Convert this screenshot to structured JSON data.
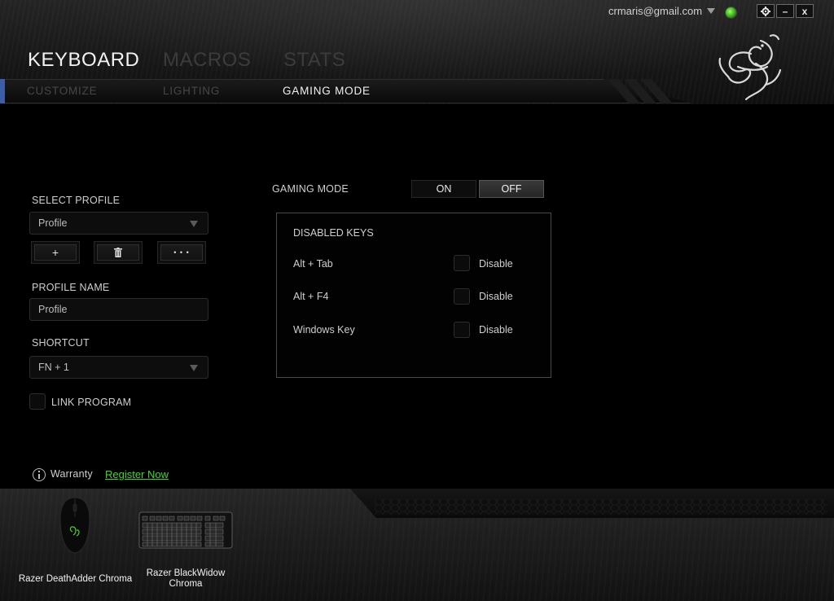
{
  "header": {
    "account_email": "crmaris@gmail.com",
    "status_color": "#44d62c",
    "window_buttons": {
      "settings_icon": "gear-icon",
      "minimize_label": "–",
      "close_label": "x"
    },
    "main_tabs": [
      {
        "label": "KEYBOARD",
        "active": true
      },
      {
        "label": "MACROS",
        "active": false
      },
      {
        "label": "STATS",
        "active": false
      }
    ],
    "sub_tabs": [
      {
        "label": "CUSTOMIZE",
        "active": false
      },
      {
        "label": "LIGHTING",
        "active": false
      },
      {
        "label": "GAMING MODE",
        "active": true
      }
    ],
    "logo_icon": "razer-snake-logo"
  },
  "profile": {
    "select_label": "SELECT PROFILE",
    "selected_profile": "Profile",
    "buttons": {
      "add_label": "+",
      "delete_icon": "trash-icon",
      "more_label": "• • •"
    },
    "name_label": "PROFILE NAME",
    "name_value": "Profile",
    "shortcut_label": "SHORTCUT",
    "shortcut_value": "FN + 1",
    "link_program_label": "LINK PROGRAM",
    "link_program_checked": false
  },
  "gaming_mode": {
    "label": "GAMING MODE",
    "on_label": "ON",
    "off_label": "OFF",
    "state": "OFF",
    "disabled_keys_title": "DISABLED KEYS",
    "keys": [
      {
        "name": "Alt + Tab",
        "action": "Disable",
        "checked": false
      },
      {
        "name": "Alt + F4",
        "action": "Disable",
        "checked": false
      },
      {
        "name": "Windows Key",
        "action": "Disable",
        "checked": false
      }
    ]
  },
  "warranty": {
    "label": "Warranty",
    "link_text": "Register Now",
    "link_color": "#44d62c"
  },
  "devices": [
    {
      "name": "Razer DeathAdder Chroma",
      "icon": "mouse-icon"
    },
    {
      "name_line1": "Razer BlackWidow",
      "name_line2": "Chroma",
      "icon": "keyboard-icon"
    }
  ],
  "colors": {
    "accent": "#44d62c",
    "subnav_edge": "#3b5ea8"
  }
}
